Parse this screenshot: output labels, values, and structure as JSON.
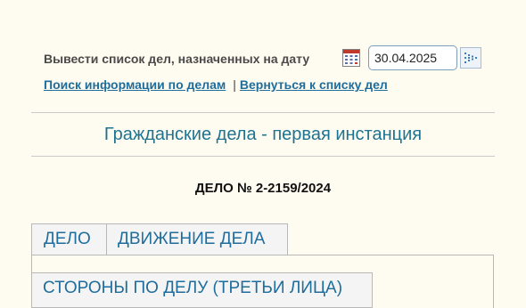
{
  "date_selector": {
    "label": "Вывести список дел, назначенных на дату",
    "date_value": "30.04.2025",
    "calendar_icon": "calendar-icon",
    "go_icon": "go-arrow-icon"
  },
  "links": {
    "search": "Поиск информации по делам",
    "separator": "|",
    "back": "Вернуться к списку дел"
  },
  "section_title": "Гражданские дела - первая инстанция",
  "case_number": "ДЕЛО № 2-2159/2024",
  "tabs": [
    {
      "label": "ДЕЛО"
    },
    {
      "label": "ДВИЖЕНИЕ ДЕЛА"
    },
    {
      "label": "СТОРОНЫ ПО ДЕЛУ (ТРЕТЬИ ЛИЦА)"
    }
  ],
  "colors": {
    "background": "#fefbf0",
    "link": "#1e6d9c",
    "title": "#1e7391"
  }
}
